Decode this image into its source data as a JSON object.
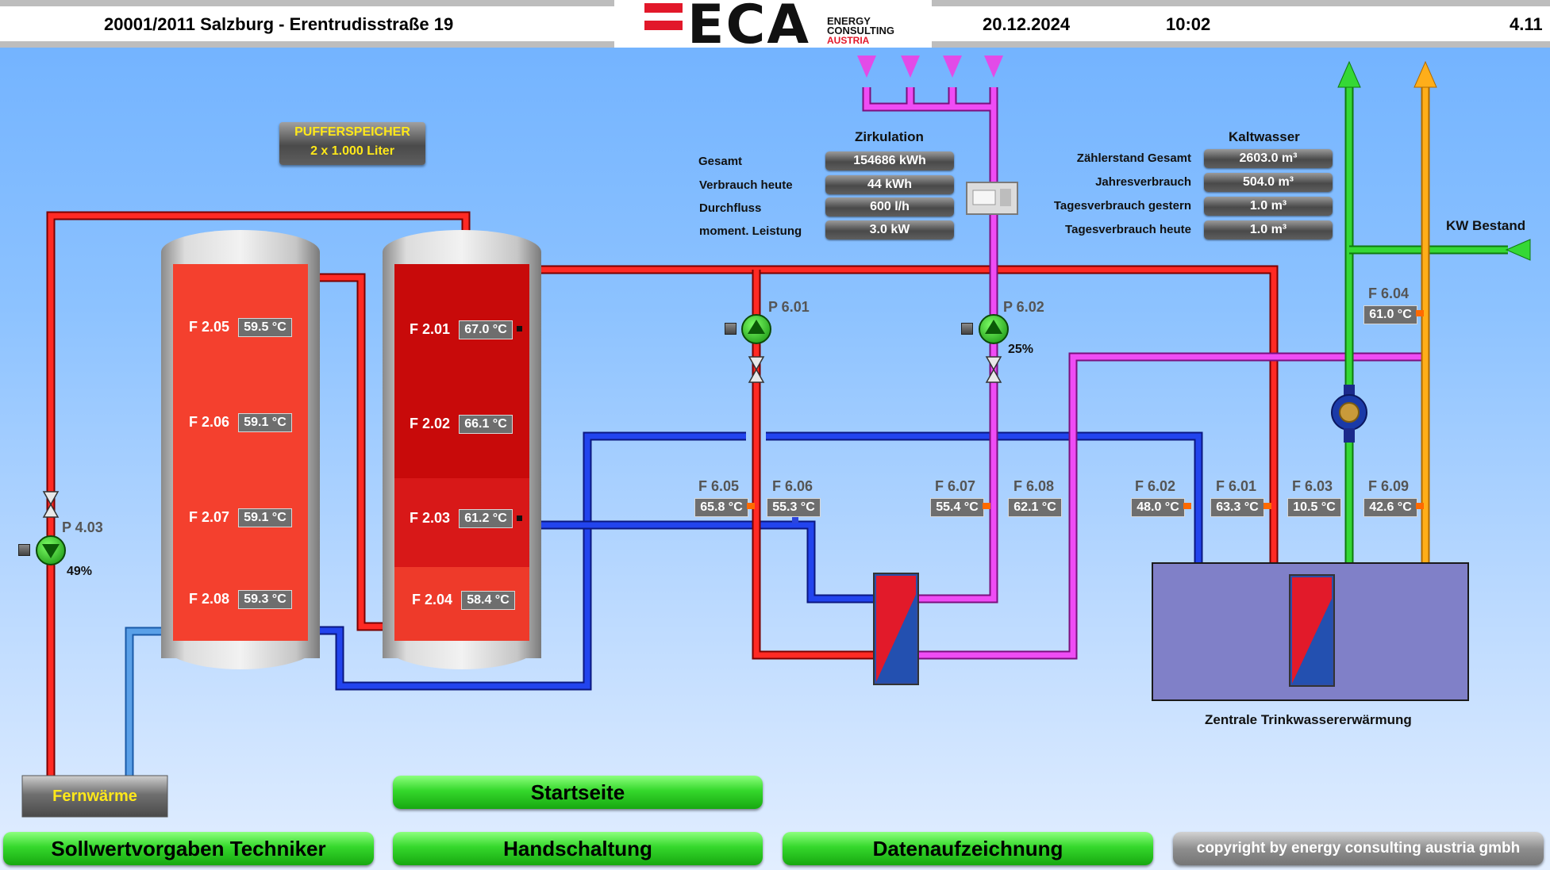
{
  "header": {
    "site": "20001/2011 Salzburg - Erentrudisstraße 19",
    "date": "20.12.2024",
    "time": "10:02",
    "page_number": "4.11",
    "logo": {
      "mark": "ECA",
      "line1": "ENERGY",
      "line2": "CONSULTING",
      "line3": "AUSTRIA"
    }
  },
  "buffer": {
    "title": "PUFFERSPEICHER",
    "subtitle": "2 x 1.000 Liter"
  },
  "tank_left": [
    {
      "label": "F 2.05",
      "value": "59.5 °C"
    },
    {
      "label": "F 2.06",
      "value": "59.1 °C"
    },
    {
      "label": "F 2.07",
      "value": "59.1 °C"
    },
    {
      "label": "F 2.08",
      "value": "59.3 °C"
    }
  ],
  "tank_right": [
    {
      "label": "F 2.01",
      "value": "67.0 °C"
    },
    {
      "label": "F 2.02",
      "value": "66.1 °C"
    },
    {
      "label": "F 2.03",
      "value": "61.2 °C"
    },
    {
      "label": "F 2.04",
      "value": "58.4 °C"
    }
  ],
  "zirkulation": {
    "title": "Zirkulation",
    "rows": [
      {
        "label": "Gesamt",
        "value": "154686 kWh"
      },
      {
        "label": "Verbrauch heute",
        "value": "44 kWh"
      },
      {
        "label": "Durchfluss",
        "value": "600 l/h"
      },
      {
        "label": "moment. Leistung",
        "value": "3.0 kW"
      }
    ]
  },
  "kaltwasser": {
    "title": "Kaltwasser",
    "rows": [
      {
        "label": "Zählerstand Gesamt",
        "value": "2603.0 m³"
      },
      {
        "label": "Jahresverbrauch",
        "value": "504.0 m³"
      },
      {
        "label": "Tagesverbrauch gestern",
        "value": "1.0 m³"
      },
      {
        "label": "Tagesverbrauch heute",
        "value": "1.0 m³"
      }
    ]
  },
  "kw_bestand": "KW Bestand",
  "pumps": {
    "p601": {
      "label": "P 6.01"
    },
    "p602": {
      "label": "P 6.02",
      "percent": "25%"
    },
    "p403": {
      "label": "P 4.03",
      "percent": "49%"
    }
  },
  "sensors": {
    "f605": {
      "label": "F 6.05",
      "value": "65.8 °C"
    },
    "f606": {
      "label": "F 6.06",
      "value": "55.3 °C"
    },
    "f607": {
      "label": "F 6.07",
      "value": "55.4 °C"
    },
    "f608": {
      "label": "F 6.08",
      "value": "62.1 °C"
    },
    "f602": {
      "label": "F 6.02",
      "value": "48.0 °C"
    },
    "f601": {
      "label": "F 6.01",
      "value": "63.3 °C"
    },
    "f603": {
      "label": "F 6.03",
      "value": "10.5 °C"
    },
    "f609": {
      "label": "F 6.09",
      "value": "42.6 °C"
    },
    "f604": {
      "label": "F 6.04",
      "value": "61.0 °C"
    }
  },
  "fernwaerme": "Fernwärme",
  "zentrale": "Zentrale Trinkwassererwärmung",
  "buttons": {
    "startseite": "Startseite",
    "sollwert": "Sollwertvorgaben Techniker",
    "hand": "Handschaltung",
    "daten": "Datenaufzeichnung",
    "copyright": "copyright by energy consulting austria gmbh"
  },
  "colors": {
    "hot": "#e0221e",
    "cold": "#2233cc",
    "circulation": "#e040e8",
    "cold_water": "#2fd02f",
    "warm_water": "#ffa500",
    "tank_left_fill": "#f4402e",
    "tank_right_hot": "#c80a0a",
    "tank_right_mid": "#d81818",
    "tank_right_low": "#ee3a2a"
  }
}
